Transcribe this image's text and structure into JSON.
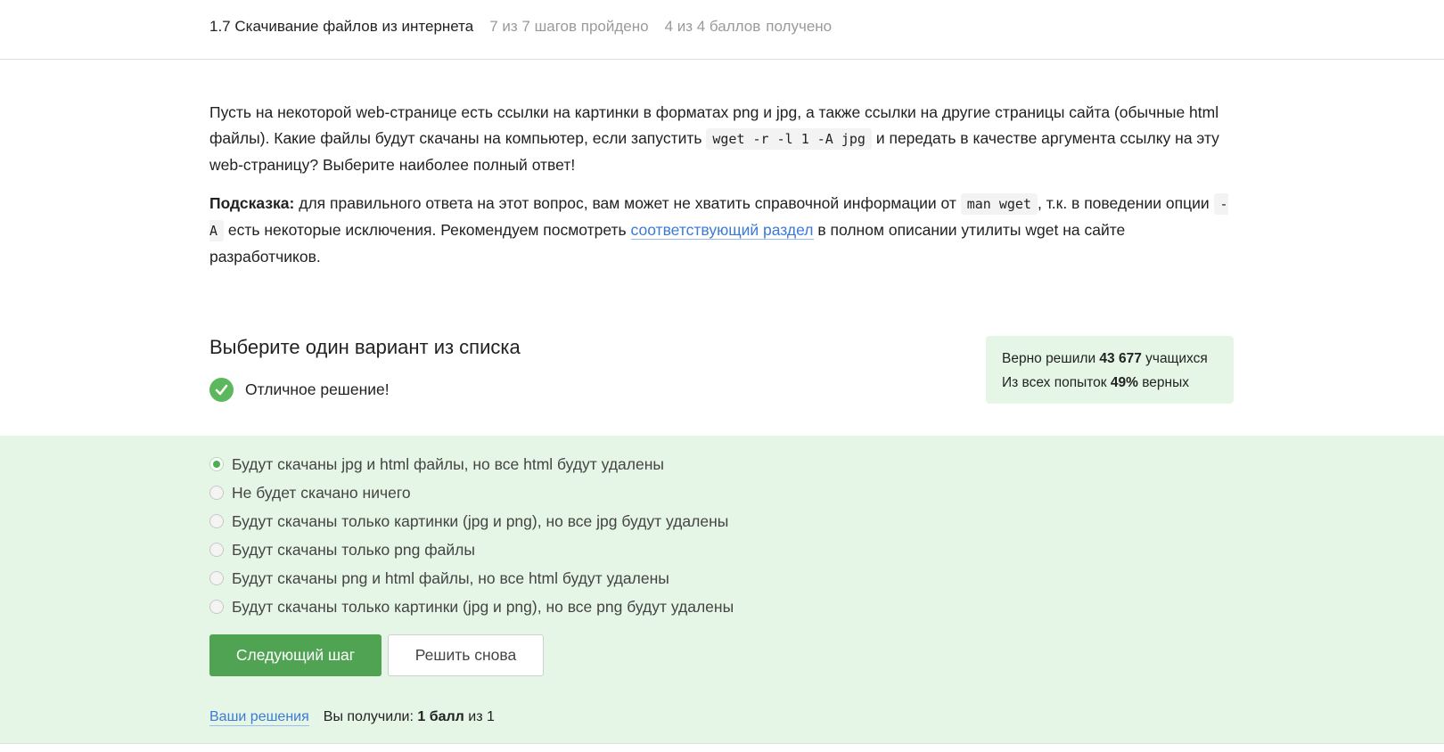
{
  "header": {
    "lesson_title": "1.7 Скачивание файлов из интернета",
    "steps_progress": "7 из 7 шагов пройдено",
    "points_value": "4 из 4 баллов",
    "points_suffix": "получено"
  },
  "question": {
    "p1_part1": "Пусть на некоторой web-странице есть ссылки на картинки в форматах png и jpg, а также ссылки на другие страницы сайта (обычные html файлы). Какие файлы будут скачаны на компьютер, если запустить ",
    "p1_code": "wget -r -l 1 -A jpg",
    "p1_part2": " и передать в качестве аргумента ссылку на эту web-страницу? Выберите наиболее полный ответ!",
    "hint_label": "Подсказка:",
    "hint_part1": " для правильного ответа на этот вопрос, вам может не хватить справочной информации от ",
    "hint_code1": "man wget",
    "hint_part2": ", т.к. в поведении опции ",
    "hint_code2": "-A",
    "hint_part3": " есть некоторые исключения. Рекомендуем посмотреть ",
    "hint_link": "соответствующий раздел",
    "hint_part4": " в полном описании утилиты wget на сайте разработчиков."
  },
  "quiz": {
    "title": "Выберите один вариант из списка",
    "status_text": "Отличное решение!",
    "stats": {
      "line1_prefix": "Верно решили ",
      "line1_value": "43 677",
      "line1_suffix": " учащихся",
      "line2_prefix": "Из всех попыток ",
      "line2_value": "49%",
      "line2_suffix": " верных"
    },
    "options": [
      {
        "label": "Будут скачаны jpg и html файлы, но все html будут удалены",
        "selected": true
      },
      {
        "label": "Не будет скачано ничего",
        "selected": false
      },
      {
        "label": "Будут скачаны только картинки (jpg и png), но все jpg будут удалены",
        "selected": false
      },
      {
        "label": "Будут скачаны только png файлы",
        "selected": false
      },
      {
        "label": "Будут скачаны png и html файлы, но все html будут удалены",
        "selected": false
      },
      {
        "label": "Будут скачаны только картинки (jpg и png), но все png будут удалены",
        "selected": false
      }
    ],
    "next_button": "Следующий шаг",
    "retry_button": "Решить снова",
    "footer": {
      "solutions_link": "Ваши решения",
      "result_prefix": "Вы получили: ",
      "result_value": "1 балл",
      "result_suffix": " из 1"
    }
  },
  "colors": {
    "accent_green": "#4fa353",
    "answer_bg": "#e6f6e6",
    "link_blue": "#3b7ad6"
  }
}
